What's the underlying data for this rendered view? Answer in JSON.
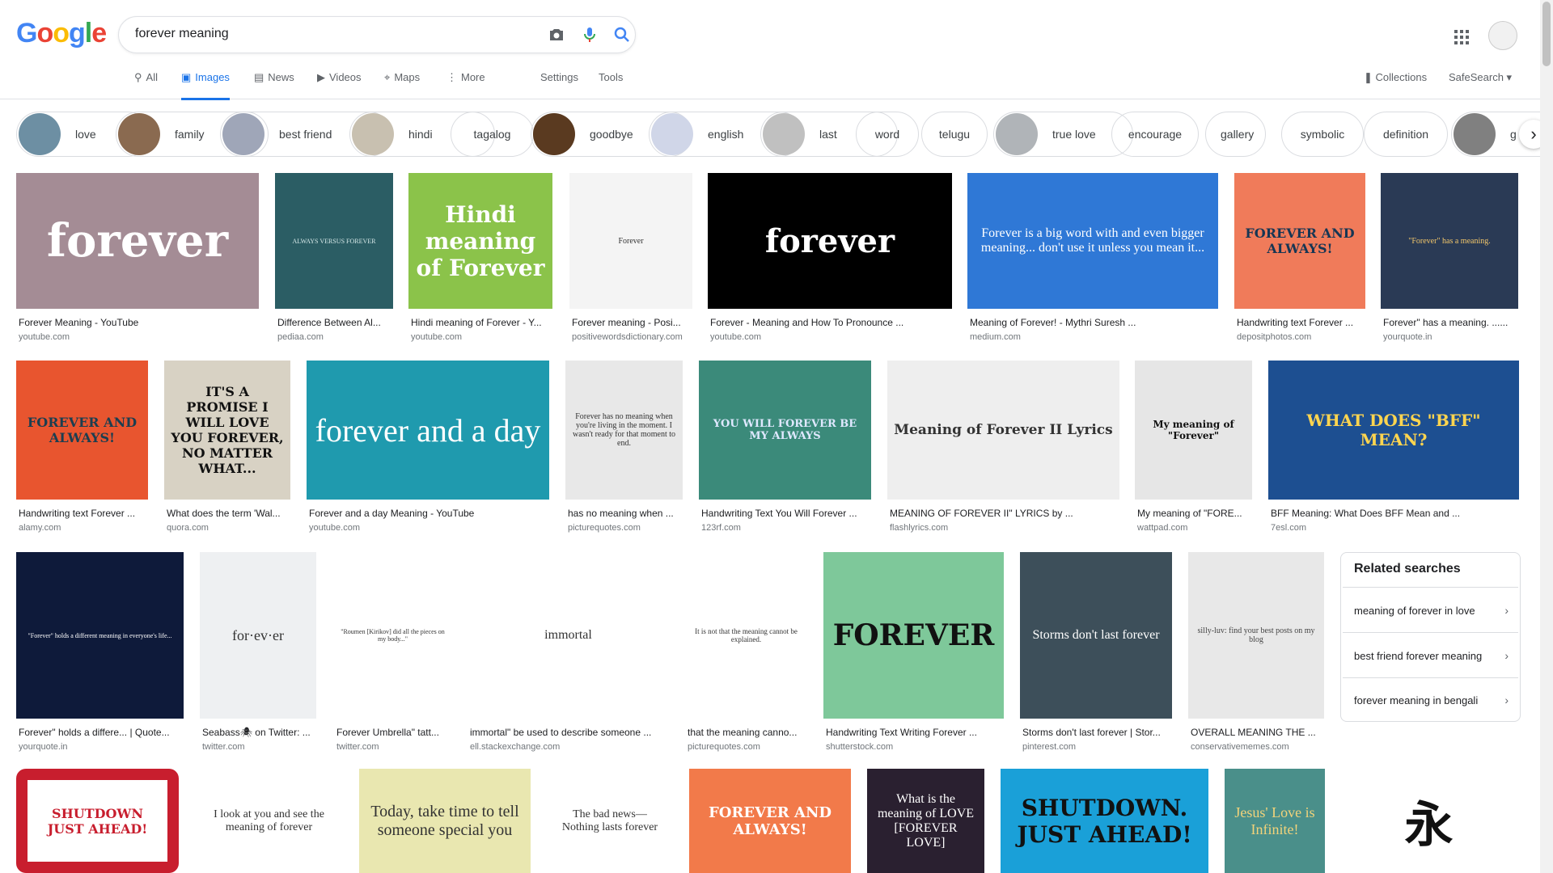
{
  "logo": {
    "letters": [
      "G",
      "o",
      "o",
      "g",
      "l",
      "e"
    ],
    "colors": [
      "#4285F4",
      "#EA4335",
      "#FBBC05",
      "#4285F4",
      "#34A853",
      "#EA4335"
    ]
  },
  "search": {
    "value": "forever meaning"
  },
  "tabs": [
    {
      "label": "All",
      "icon": "search-icon"
    },
    {
      "label": "Images",
      "icon": "image-icon"
    },
    {
      "label": "News",
      "icon": "news-icon"
    },
    {
      "label": "Videos",
      "icon": "video-icon"
    },
    {
      "label": "Maps",
      "icon": "map-icon"
    },
    {
      "label": "More",
      "icon": "more-icon"
    }
  ],
  "settings_label": "Settings",
  "tools_label": "Tools",
  "collections_label": "Collections",
  "safesearch_label": "SafeSearch ▾",
  "chips": [
    "love",
    "family",
    "best friend",
    "hindi",
    "tagalog",
    "goodbye",
    "english",
    "last",
    "word",
    "telugu",
    "true love",
    "encourage",
    "gallery",
    "symbolic",
    "definition",
    "g"
  ],
  "results": [
    {
      "caption": "Forever Meaning - YouTube",
      "source": "youtube.com",
      "overlay": "forever"
    },
    {
      "caption": "Difference Between Al...",
      "source": "pediaa.com",
      "overlay": "ALWAYS VERSUS FOREVER"
    },
    {
      "caption": "Hindi meaning of Forever - Y...",
      "source": "youtube.com",
      "overlay": "Hindi meaning of Forever"
    },
    {
      "caption": "Forever meaning - Posi...",
      "source": "positivewordsdictionary.com",
      "overlay": "Forever"
    },
    {
      "caption": "Forever - Meaning and How To Pronounce ...",
      "source": "youtube.com",
      "overlay": "forever"
    },
    {
      "caption": "Meaning of Forever! - Mythri Suresh ...",
      "source": "medium.com",
      "overlay": "Forever is a big word with and even bigger meaning... don't use it unless you mean it..."
    },
    {
      "caption": "Handwriting text Forever ...",
      "source": "depositphotos.com",
      "overlay": "FOREVER AND ALWAYS!"
    },
    {
      "caption": "Forever\" has a meaning. ......",
      "source": "yourquote.in",
      "overlay": "\"Forever\" has a meaning."
    },
    {
      "caption": "Handwriting text Forever ...",
      "source": "alamy.com",
      "overlay": "FOREVER AND ALWAYS!"
    },
    {
      "caption": "What does the term 'Wal...",
      "source": "quora.com",
      "overlay": "IT'S A PROMISE I WILL LOVE YOU FOREVER, NO MATTER WHAT..."
    },
    {
      "caption": "Forever and a day Meaning - YouTube",
      "source": "youtube.com",
      "overlay": "forever and a day"
    },
    {
      "caption": "has no meaning when ...",
      "source": "picturequotes.com",
      "overlay": "Forever has no meaning when you're living in the moment. I wasn't ready for that moment to end."
    },
    {
      "caption": "Handwriting Text You Will Forever ...",
      "source": "123rf.com",
      "overlay": "YOU WILL FOREVER BE MY ALWAYS"
    },
    {
      "caption": "MEANING OF FOREVER II\" LYRICS by ...",
      "source": "flashlyrics.com",
      "overlay": "Meaning of Forever II Lyrics"
    },
    {
      "caption": "My meaning of \"FORE...",
      "source": "wattpad.com",
      "overlay": "My meaning of \"Forever\""
    },
    {
      "caption": "BFF Meaning: What Does BFF Mean and ...",
      "source": "7esl.com",
      "overlay": "WHAT DOES \"BFF\" MEAN?"
    },
    {
      "caption": "Forever\" holds a differe... | Quote...",
      "source": "yourquote.in",
      "overlay": "\"Forever\" holds a different meaning in everyone's life..."
    },
    {
      "caption": "Seabass🕷 on Twitter: ...",
      "source": "twitter.com",
      "overlay": "for·ev·er"
    },
    {
      "caption": "Forever Umbrella\" tatt...",
      "source": "twitter.com",
      "overlay": "\"Roumen [Kirikov] did all the pieces on my body...\""
    },
    {
      "caption": "immortal\" be used to describe someone ...",
      "source": "ell.stackexchange.com",
      "overlay": "immortal"
    },
    {
      "caption": "that the meaning canno...",
      "source": "picturequotes.com",
      "overlay": "It is not that the meaning cannot be explained."
    },
    {
      "caption": "Handwriting Text Writing Forever ...",
      "source": "shutterstock.com",
      "overlay": "FOREVER"
    },
    {
      "caption": "Storms don't last forever | Stor...",
      "source": "pinterest.com",
      "overlay": "Storms don't last forever"
    },
    {
      "caption": "OVERALL MEANING THE ...",
      "source": "conservativememes.com",
      "overlay": "silly-luv: find your best posts on my blog"
    },
    {
      "caption": "",
      "source": "",
      "overlay": "SHUTDOWN JUST AHEAD!"
    },
    {
      "caption": "",
      "source": "",
      "overlay": "I look at you and see the meaning of forever"
    },
    {
      "caption": "",
      "source": "",
      "overlay": "Today, take time to tell someone special you"
    },
    {
      "caption": "",
      "source": "",
      "overlay": "The bad news— Nothing lasts forever"
    },
    {
      "caption": "",
      "source": "",
      "overlay": "FOREVER AND ALWAYS!"
    },
    {
      "caption": "",
      "source": "",
      "overlay": "What is the meaning of LOVE [FOREVER LOVE]"
    },
    {
      "caption": "",
      "source": "",
      "overlay": "SHUTDOWN. JUST AHEAD!"
    },
    {
      "caption": "",
      "source": "",
      "overlay": "Jesus' Love is Infinite!"
    },
    {
      "caption": "",
      "source": "",
      "overlay": "永"
    }
  ],
  "related": {
    "title": "Related searches",
    "items": [
      "meaning of forever in love",
      "best friend forever meaning",
      "forever meaning in bengali"
    ]
  }
}
